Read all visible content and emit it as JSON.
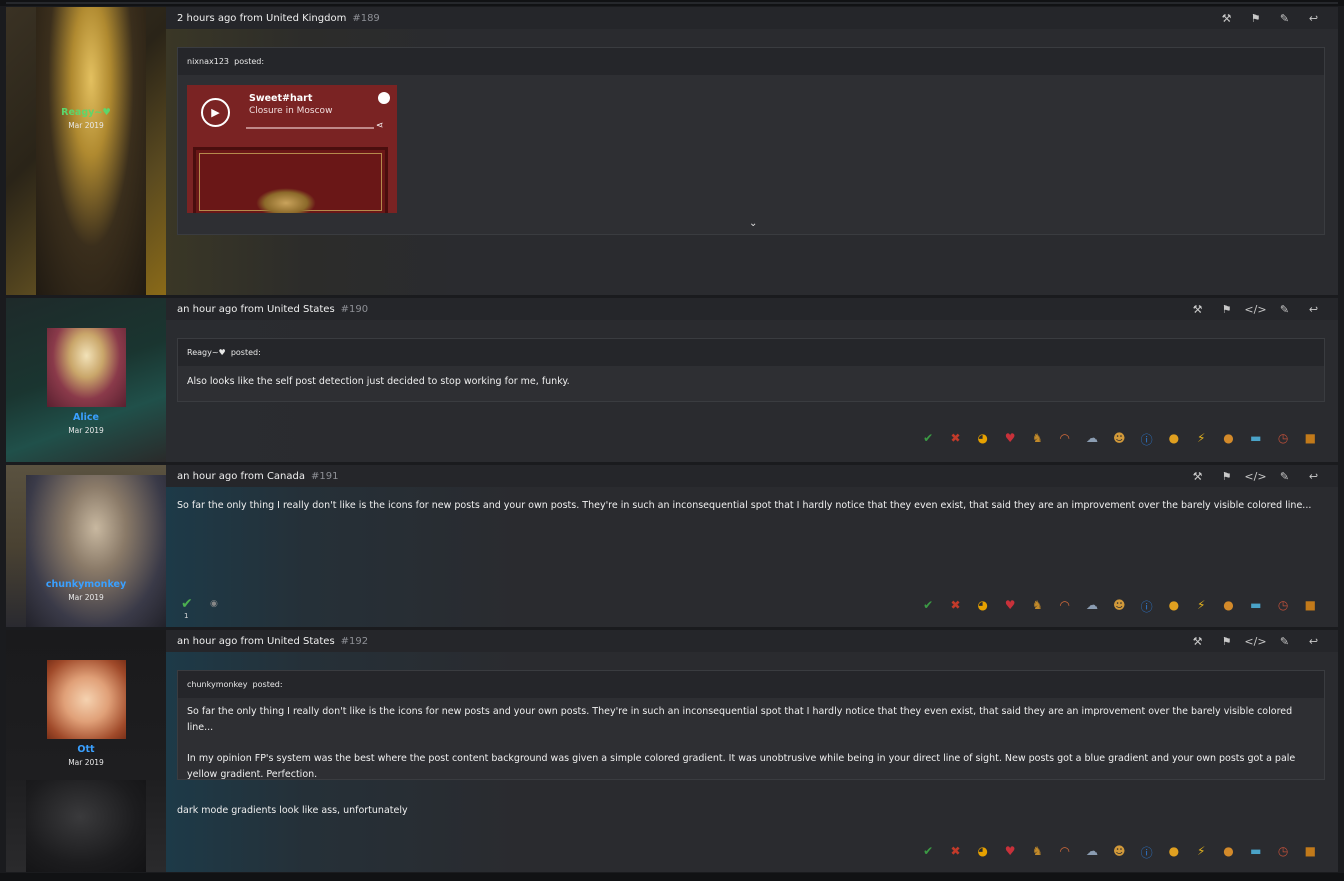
{
  "posts": [
    {
      "meta": "2 hours ago from United Kingdom",
      "num": "#189",
      "user": {
        "name": "Reagy~♥",
        "joined": "Mar 2019",
        "color": "#5dd66b"
      },
      "quote": {
        "header_user": "nixnax123",
        "header_suffix": "posted:"
      },
      "embed": {
        "artist": "Sweet#hart",
        "track": "Closure in Moscow"
      },
      "actions": [
        "hammer-icon",
        "flag-icon",
        "pencil-icon",
        "reply-icon"
      ]
    },
    {
      "meta": "an hour ago from United States",
      "num": "#190",
      "user": {
        "name": "Alice",
        "joined": "Mar 2019",
        "color": "#3aa0ff"
      },
      "quote": {
        "header_user": "Reagy~♥",
        "header_suffix": "posted:",
        "body": "Also looks like the self post detection just decided to stop working for me, funky."
      },
      "actions": [
        "hammer-icon",
        "flag-icon",
        "code-icon",
        "pencil-icon",
        "reply-icon"
      ]
    },
    {
      "meta": "an hour ago from Canada",
      "num": "#191",
      "user": {
        "name": "chunkymonkey",
        "joined": "Mar 2019",
        "color": "#3aa0ff"
      },
      "body": "So far the only thing I really don't like is the icons for new posts and your own posts. They're in such an inconsequential spot that I hardly notice that they even exist, that said they are an improvement over the barely visible colored line...",
      "rating_count": "1",
      "actions": [
        "hammer-icon",
        "flag-icon",
        "code-icon",
        "pencil-icon",
        "reply-icon"
      ]
    },
    {
      "meta": "an hour ago from United States",
      "num": "#192",
      "user": {
        "name": "Ott",
        "joined": "Mar 2019",
        "color": "#3aa0ff"
      },
      "quote": {
        "header_user": "chunkymonkey",
        "header_suffix": "posted:",
        "body1": "So far the only thing I really don't like is the icons for new posts and your own posts. They're in such an inconsequential spot that I hardly notice that they even exist, that said they are an improvement over the barely visible colored line...",
        "body2": "In my opinion FP's system was the best where the post content background was given a simple colored gradient. It was unobtrusive while being in your direct line of sight. New posts got a blue gradient and your own posts got a pale yellow gradient. Perfection."
      },
      "body": "dark mode gradients look like ass, unfortunately",
      "actions": [
        "hammer-icon",
        "flag-icon",
        "code-icon",
        "pencil-icon",
        "reply-icon"
      ]
    }
  ],
  "reactions": [
    {
      "name": "agree-icon",
      "glyph": "✔",
      "color": "#3b9a44"
    },
    {
      "name": "disagree-icon",
      "glyph": "✖",
      "color": "#c23a2a"
    },
    {
      "name": "funny-icon",
      "glyph": "◕",
      "color": "#e6a100"
    },
    {
      "name": "love-icon",
      "glyph": "♥",
      "color": "#c8313a"
    },
    {
      "name": "winner-icon",
      "glyph": "♞",
      "color": "#c28a2a"
    },
    {
      "name": "artistic-icon",
      "glyph": "◠",
      "color": "#d46b3a"
    },
    {
      "name": "late-icon",
      "glyph": "☁",
      "color": "#8b9db2"
    },
    {
      "name": "smart-icon",
      "glyph": "☻",
      "color": "#d1993a"
    },
    {
      "name": "informative-icon",
      "glyph": "ⓘ",
      "color": "#2e7bd4"
    },
    {
      "name": "idea-icon",
      "glyph": "●",
      "color": "#e0a020"
    },
    {
      "name": "zing-icon",
      "glyph": "⚡",
      "color": "#e3b21d"
    },
    {
      "name": "friendly-icon",
      "glyph": "●",
      "color": "#d38a2a"
    },
    {
      "name": "optimistic-icon",
      "glyph": "▬",
      "color": "#4aa3c8"
    },
    {
      "name": "late-reply-icon",
      "glyph": "◷",
      "color": "#c0503a"
    },
    {
      "name": "box-icon",
      "glyph": "■",
      "color": "#c27a1a"
    }
  ]
}
